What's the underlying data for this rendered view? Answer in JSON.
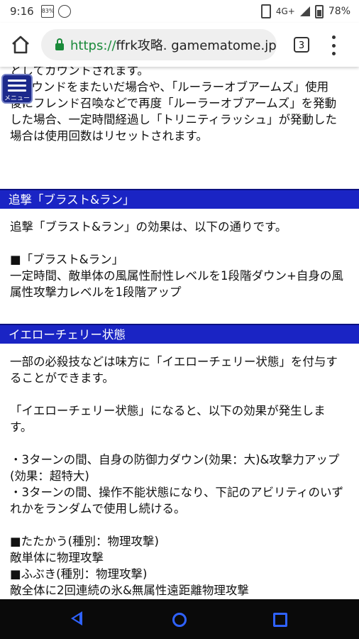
{
  "status_bar": {
    "time": "9:16",
    "badge_text": "83%",
    "network": "4G+",
    "battery": "78%"
  },
  "browser": {
    "url_scheme": "https://",
    "url_host": "ffrk攻略. gamematome.jp",
    "tab_count": "3"
  },
  "menu_button": {
    "label": "メニュー"
  },
  "article": {
    "intro_lines": [
      "としてカウントされます。",
      "※ラウンドをまたいだ場合や、「ルーラーオブアームズ」使用",
      "後にフレンド召喚などで再度「ルーラーオブアームズ」を発動",
      "した場合、一定時間経過し「トリニティラッシュ」が発動した",
      "場合は使用回数はリセットされます。"
    ],
    "section1": {
      "heading": "追撃「ブラスト&ラン」",
      "lines": [
        "追撃「ブラスト&ラン」の効果は、以下の通りです。",
        "",
        "■「ブラスト&ラン」",
        "一定時間、敵単体の風属性耐性レベルを1段階ダウン+自身の風",
        "属性攻撃力レベルを1段階アップ"
      ]
    },
    "section2": {
      "heading": "イエローチェリー状態",
      "lines": [
        "一部の必殺技などは味方に「イエローチェリー状態」を付与す",
        "ることができます。",
        "",
        "「イエローチェリー状態」になると、以下の効果が発生しま",
        "す。",
        "",
        "・3ターンの間、自身の防御力ダウン(効果：大)&攻撃力アップ",
        "(効果：超特大)",
        "・3ターンの間、操作不能状態になり、下記のアビリティのいず",
        "れかをランダムで使用し続ける。",
        "",
        "■たたかう(種別：物理攻撃)",
        "敵単体に物理攻撃",
        "■ふぶき(種別：物理攻撃)",
        "敵全体に2回連続の氷&無属性遠距離物理攻撃"
      ]
    }
  },
  "colors": {
    "section_header": "#1a24c4",
    "nav_icons": "#2f62ff",
    "secure": "#1a8a3a"
  }
}
